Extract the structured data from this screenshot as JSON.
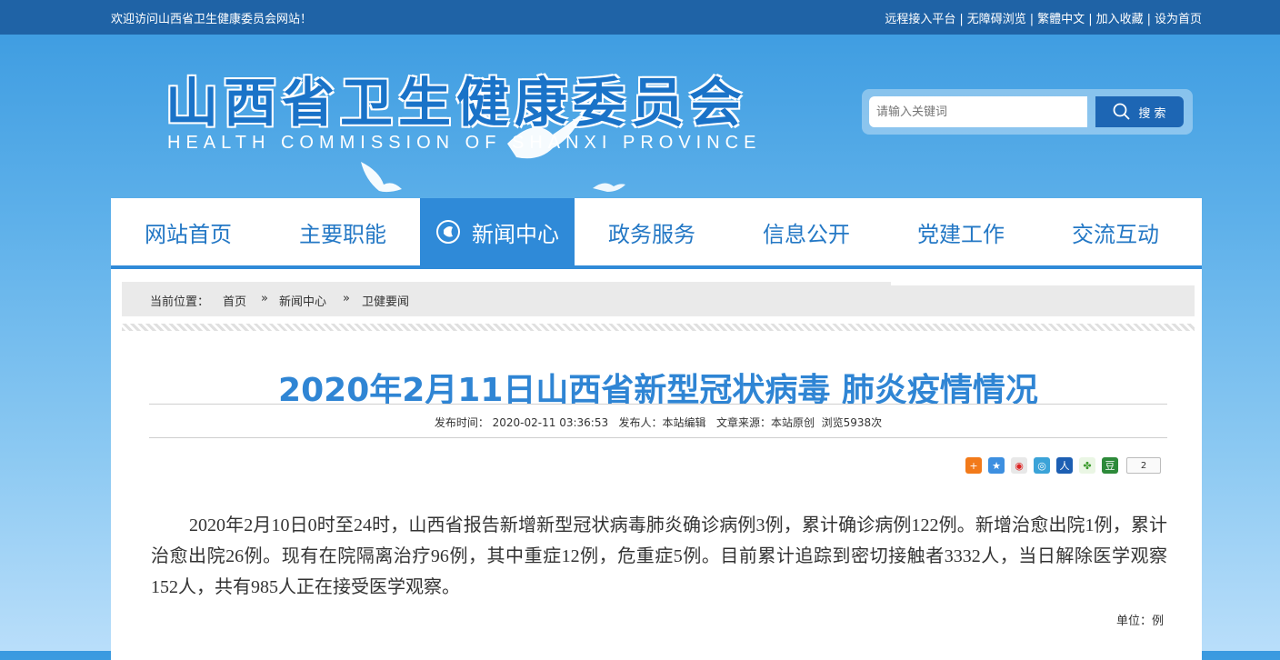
{
  "topbar": {
    "welcome": "欢迎访问山西省卫生健康委员会网站！",
    "links": [
      "远程接入平台",
      "无障碍浏览",
      "繁體中文",
      "加入收藏",
      "设为首页"
    ],
    "separator": "|"
  },
  "header": {
    "logo_cn": "山西省卫生健康委员会",
    "logo_en": "HEALTH COMMISSION OF SHANXI PROVINCE"
  },
  "search": {
    "placeholder": "请输入关键词",
    "button_label": "搜 索",
    "icon": "search-icon"
  },
  "nav": {
    "items": [
      {
        "label": "网站首页"
      },
      {
        "label": "主要职能"
      },
      {
        "label": "新闻中心",
        "active": true
      },
      {
        "label": "政务服务"
      },
      {
        "label": "信息公开"
      },
      {
        "label": "党建工作"
      },
      {
        "label": "交流互动"
      }
    ],
    "active_color": "#2f8ad8",
    "text_color": "#2478c5"
  },
  "breadcrumb": {
    "prefix": "当前位置：",
    "items": [
      "首页",
      "新闻中心",
      "卫健要闻"
    ],
    "separator": "»"
  },
  "article": {
    "title": "2020年2月11日山西省新型冠状病毒 肺炎疫情情况",
    "meta": "发布时间： 2020-02-11 03:36:53   发布人：本站编辑   文章来源：本站原创  浏览5938次",
    "share_count": "2",
    "body": "2020年2月10日0时至24时，山西省报告新增新型冠状病毒肺炎确诊病例3例，累计确诊病例122例。新增治愈出院1例，累计治愈出院26例。现有在院隔离治疗96例，其中重症12例，危重症5例。目前累计追踪到密切接触者3332人，当日解除医学观察152人，共有985人正在接受医学观察。",
    "unit": "单位：例",
    "title_color": "#2f85d4"
  }
}
